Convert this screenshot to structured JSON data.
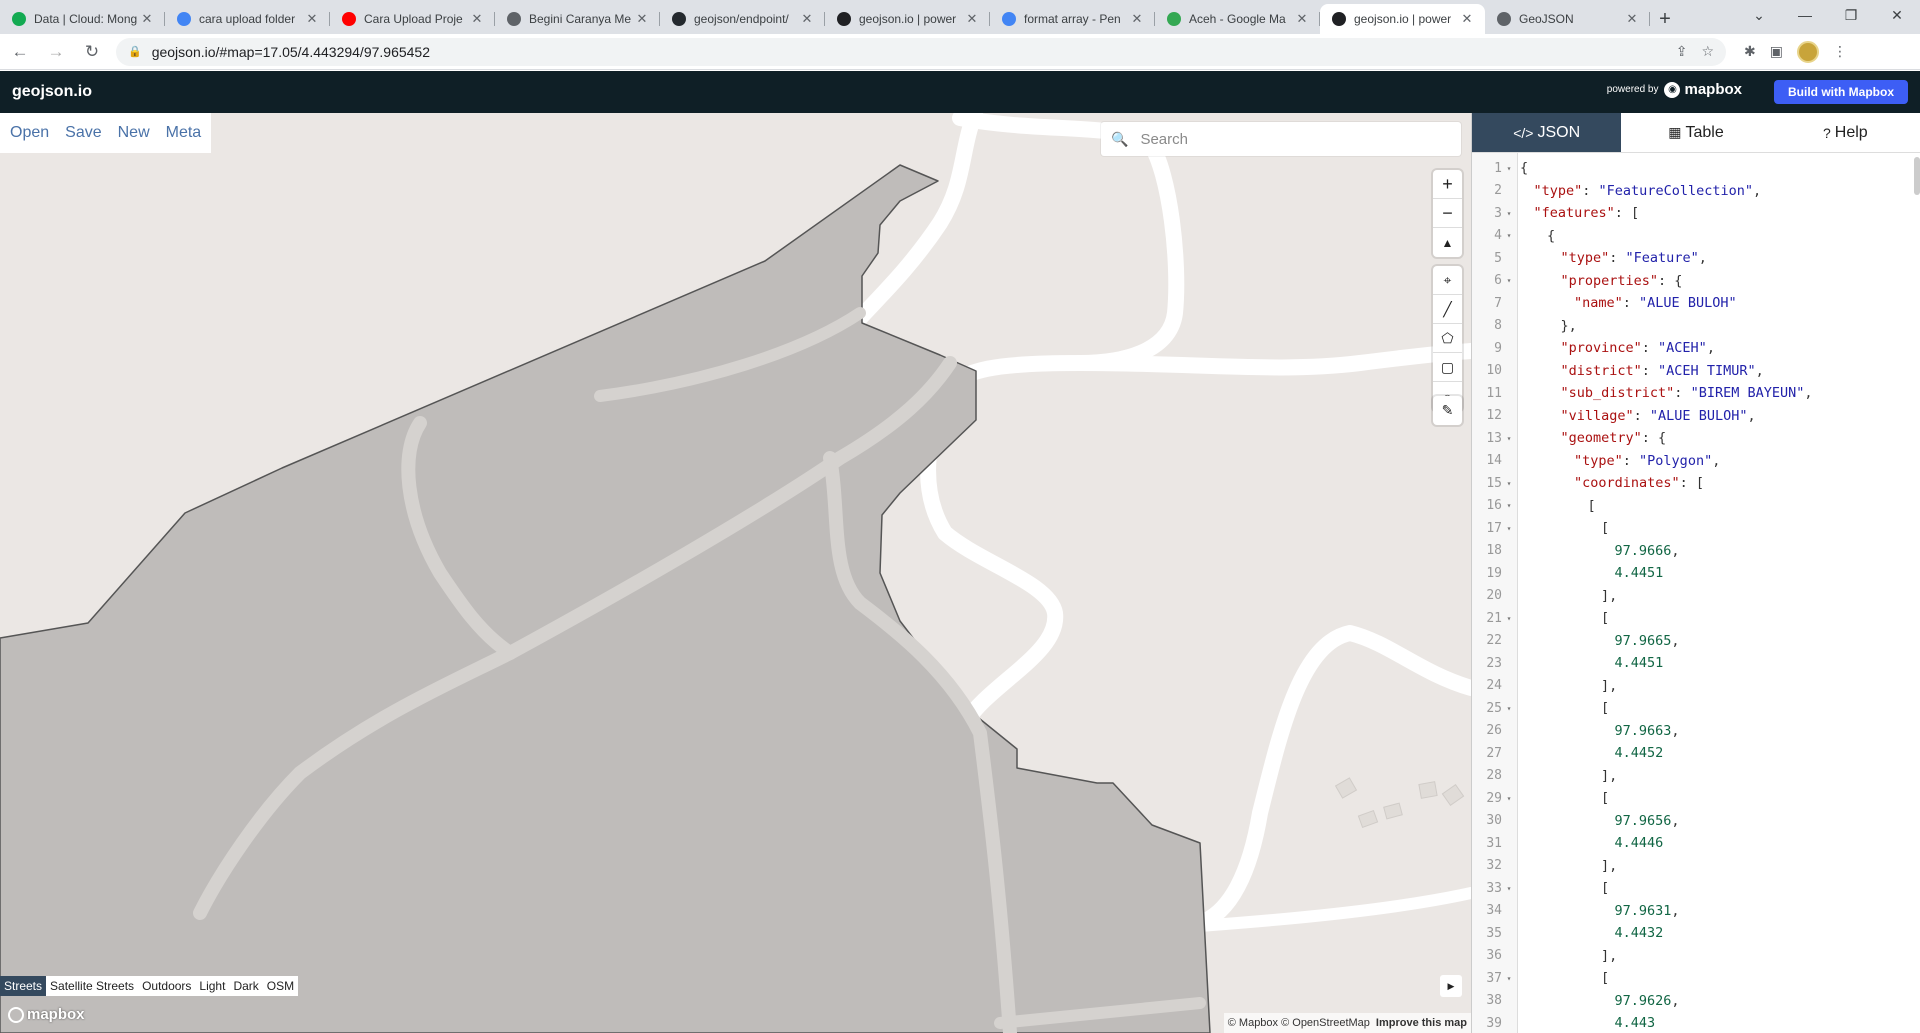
{
  "browser": {
    "tabs": [
      {
        "title": "Data | Cloud: Mong",
        "icon": "mongodb-leaf-icon",
        "color": "#13aa52"
      },
      {
        "title": "cara upload folder",
        "icon": "google-g-icon",
        "color": "#4285f4"
      },
      {
        "title": "Cara Upload Proje",
        "icon": "youtube-icon",
        "color": "#ff0000"
      },
      {
        "title": "Begini Caranya Me",
        "icon": "globe-icon",
        "color": "#5f6368"
      },
      {
        "title": "geojson/endpoint/",
        "icon": "github-icon",
        "color": "#24292e"
      },
      {
        "title": "geojson.io | power",
        "icon": "geojson-icon",
        "color": "#202124"
      },
      {
        "title": "format array - Pen",
        "icon": "google-g-icon",
        "color": "#4285f4"
      },
      {
        "title": "Aceh - Google Ma",
        "icon": "maps-pin-icon",
        "color": "#34a853"
      },
      {
        "title": "geojson.io | power",
        "icon": "geojson-icon",
        "color": "#202124",
        "active": true
      },
      {
        "title": "GeoJSON",
        "icon": "globe-icon",
        "color": "#5f6368"
      }
    ],
    "new_tab": "+",
    "url": "geojson.io/#map=17.05/4.443294/97.965452"
  },
  "app": {
    "logo": "geojson.io",
    "powered_by": "powered by",
    "mapbox_word": "mapbox",
    "build_button": "Build with Mapbox"
  },
  "map": {
    "file_menu": [
      "Open",
      "Save",
      "New",
      "Meta"
    ],
    "search_placeholder": "Search",
    "layers": [
      "Streets",
      "Satellite Streets",
      "Outdoors",
      "Light",
      "Dark",
      "OSM"
    ],
    "active_layer": "Streets",
    "logo": "mapbox",
    "attribution": "© Mapbox © OpenStreetMap",
    "improve": "Improve this map"
  },
  "panel": {
    "tabs": [
      {
        "label": "JSON",
        "icon": "code-icon",
        "active": true
      },
      {
        "label": "Table",
        "icon": "table-icon"
      },
      {
        "label": "Help",
        "icon": "help-icon"
      }
    ]
  },
  "code_lines": [
    {
      "n": "1",
      "f": true,
      "i": 0,
      "t": [
        [
          "p",
          "{"
        ]
      ]
    },
    {
      "n": "2",
      "f": false,
      "i": 1,
      "t": [
        [
          "k",
          "\"type\""
        ],
        [
          "p",
          ": "
        ],
        [
          "s",
          "\"FeatureCollection\""
        ],
        [
          "p",
          ","
        ]
      ]
    },
    {
      "n": "3",
      "f": true,
      "i": 1,
      "t": [
        [
          "k",
          "\"features\""
        ],
        [
          "p",
          ": ["
        ]
      ]
    },
    {
      "n": "4",
      "f": true,
      "i": 2,
      "t": [
        [
          "p",
          "{"
        ]
      ]
    },
    {
      "n": "5",
      "f": false,
      "i": 3,
      "t": [
        [
          "k",
          "\"type\""
        ],
        [
          "p",
          ": "
        ],
        [
          "s",
          "\"Feature\""
        ],
        [
          "p",
          ","
        ]
      ]
    },
    {
      "n": "6",
      "f": true,
      "i": 3,
      "t": [
        [
          "k",
          "\"properties\""
        ],
        [
          "p",
          ": {"
        ]
      ]
    },
    {
      "n": "7",
      "f": false,
      "i": 4,
      "t": [
        [
          "k",
          "\"name\""
        ],
        [
          "p",
          ": "
        ],
        [
          "s",
          "\"ALUE BULOH\""
        ]
      ]
    },
    {
      "n": "8",
      "f": false,
      "i": 3,
      "t": [
        [
          "p",
          "},"
        ]
      ]
    },
    {
      "n": "9",
      "f": false,
      "i": 3,
      "t": [
        [
          "k",
          "\"province\""
        ],
        [
          "p",
          ": "
        ],
        [
          "s",
          "\"ACEH\""
        ],
        [
          "p",
          ","
        ]
      ]
    },
    {
      "n": "10",
      "f": false,
      "i": 3,
      "t": [
        [
          "k",
          "\"district\""
        ],
        [
          "p",
          ": "
        ],
        [
          "s",
          "\"ACEH TIMUR\""
        ],
        [
          "p",
          ","
        ]
      ]
    },
    {
      "n": "11",
      "f": false,
      "i": 3,
      "t": [
        [
          "k",
          "\"sub_district\""
        ],
        [
          "p",
          ": "
        ],
        [
          "s",
          "\"BIREM BAYEUN\""
        ],
        [
          "p",
          ","
        ]
      ]
    },
    {
      "n": "12",
      "f": false,
      "i": 3,
      "t": [
        [
          "k",
          "\"village\""
        ],
        [
          "p",
          ": "
        ],
        [
          "s",
          "\"ALUE BULOH\""
        ],
        [
          "p",
          ","
        ]
      ]
    },
    {
      "n": "13",
      "f": true,
      "i": 3,
      "t": [
        [
          "k",
          "\"geometry\""
        ],
        [
          "p",
          ": {"
        ]
      ]
    },
    {
      "n": "14",
      "f": false,
      "i": 4,
      "t": [
        [
          "k",
          "\"type\""
        ],
        [
          "p",
          ": "
        ],
        [
          "s",
          "\"Polygon\""
        ],
        [
          "p",
          ","
        ]
      ]
    },
    {
      "n": "15",
      "f": true,
      "i": 4,
      "t": [
        [
          "k",
          "\"coordinates\""
        ],
        [
          "p",
          ": ["
        ]
      ]
    },
    {
      "n": "16",
      "f": true,
      "i": 5,
      "t": [
        [
          "p",
          "["
        ]
      ]
    },
    {
      "n": "17",
      "f": true,
      "i": 6,
      "t": [
        [
          "p",
          "["
        ]
      ]
    },
    {
      "n": "18",
      "f": false,
      "i": 7,
      "t": [
        [
          "n",
          "97.9666"
        ],
        [
          "p",
          ","
        ]
      ]
    },
    {
      "n": "19",
      "f": false,
      "i": 7,
      "t": [
        [
          "n",
          "4.4451"
        ]
      ]
    },
    {
      "n": "20",
      "f": false,
      "i": 6,
      "t": [
        [
          "p",
          "],"
        ]
      ]
    },
    {
      "n": "21",
      "f": true,
      "i": 6,
      "t": [
        [
          "p",
          "["
        ]
      ]
    },
    {
      "n": "22",
      "f": false,
      "i": 7,
      "t": [
        [
          "n",
          "97.9665"
        ],
        [
          "p",
          ","
        ]
      ]
    },
    {
      "n": "23",
      "f": false,
      "i": 7,
      "t": [
        [
          "n",
          "4.4451"
        ]
      ]
    },
    {
      "n": "24",
      "f": false,
      "i": 6,
      "t": [
        [
          "p",
          "],"
        ]
      ]
    },
    {
      "n": "25",
      "f": true,
      "i": 6,
      "t": [
        [
          "p",
          "["
        ]
      ]
    },
    {
      "n": "26",
      "f": false,
      "i": 7,
      "t": [
        [
          "n",
          "97.9663"
        ],
        [
          "p",
          ","
        ]
      ]
    },
    {
      "n": "27",
      "f": false,
      "i": 7,
      "t": [
        [
          "n",
          "4.4452"
        ]
      ]
    },
    {
      "n": "28",
      "f": false,
      "i": 6,
      "t": [
        [
          "p",
          "],"
        ]
      ]
    },
    {
      "n": "29",
      "f": true,
      "i": 6,
      "t": [
        [
          "p",
          "["
        ]
      ]
    },
    {
      "n": "30",
      "f": false,
      "i": 7,
      "t": [
        [
          "n",
          "97.9656"
        ],
        [
          "p",
          ","
        ]
      ]
    },
    {
      "n": "31",
      "f": false,
      "i": 7,
      "t": [
        [
          "n",
          "4.4446"
        ]
      ]
    },
    {
      "n": "32",
      "f": false,
      "i": 6,
      "t": [
        [
          "p",
          "],"
        ]
      ]
    },
    {
      "n": "33",
      "f": true,
      "i": 6,
      "t": [
        [
          "p",
          "["
        ]
      ]
    },
    {
      "n": "34",
      "f": false,
      "i": 7,
      "t": [
        [
          "n",
          "97.9631"
        ],
        [
          "p",
          ","
        ]
      ]
    },
    {
      "n": "35",
      "f": false,
      "i": 7,
      "t": [
        [
          "n",
          "4.4432"
        ]
      ]
    },
    {
      "n": "36",
      "f": false,
      "i": 6,
      "t": [
        [
          "p",
          "],"
        ]
      ]
    },
    {
      "n": "37",
      "f": true,
      "i": 6,
      "t": [
        [
          "p",
          "["
        ]
      ]
    },
    {
      "n": "38",
      "f": false,
      "i": 7,
      "t": [
        [
          "n",
          "97.9626"
        ],
        [
          "p",
          ","
        ]
      ]
    },
    {
      "n": "39",
      "f": false,
      "i": 7,
      "t": [
        [
          "n",
          "4.443"
        ]
      ]
    }
  ],
  "colors": {
    "header_bg": "#0f1f26",
    "accent_button": "#3d5ef5",
    "active_tab": "#34495e",
    "map_bg": "#ebe7e4",
    "polygon_fill": "#bfbcba"
  }
}
